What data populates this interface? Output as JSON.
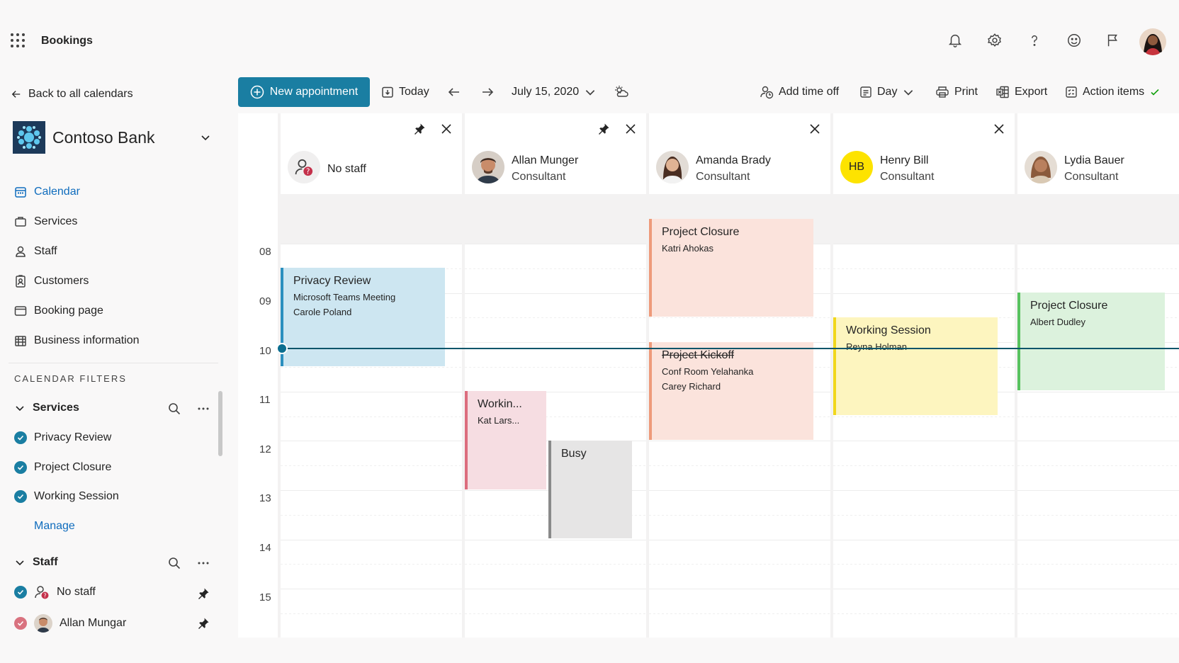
{
  "app": {
    "name": "Bookings"
  },
  "topbar": {
    "icons": [
      "bell-icon",
      "gear-icon",
      "help-icon",
      "smiley-icon",
      "flag-icon"
    ]
  },
  "sidebar": {
    "back_label": "Back to all calendars",
    "org_name": "Contoso Bank",
    "nav": [
      {
        "label": "Calendar",
        "icon": "calendar-icon",
        "active": true
      },
      {
        "label": "Services",
        "icon": "briefcase-icon"
      },
      {
        "label": "Staff",
        "icon": "person-icon"
      },
      {
        "label": "Customers",
        "icon": "contact-card-icon"
      },
      {
        "label": "Booking page",
        "icon": "web-page-icon"
      },
      {
        "label": "Business information",
        "icon": "building-icon"
      }
    ],
    "filters_heading": "CALENDAR FILTERS",
    "services_group": {
      "label": "Services",
      "items": [
        "Privacy Review",
        "Project Closure",
        "Working Session"
      ],
      "manage_label": "Manage"
    },
    "staff_group": {
      "label": "Staff",
      "items": [
        {
          "label": "No staff",
          "check_color": "#1a7ea2"
        },
        {
          "label": "Allan Mungar",
          "check_color": "#d9727f"
        }
      ]
    }
  },
  "toolbar": {
    "new_appointment": "New appointment",
    "today": "Today",
    "date": "July 15, 2020",
    "add_time_off": "Add time off",
    "view": "Day",
    "print": "Print",
    "export": "Export",
    "action_items": "Action items"
  },
  "calendar": {
    "hours": [
      "08",
      "09",
      "10",
      "11",
      "12",
      "13",
      "14",
      "15"
    ],
    "columns": [
      {
        "name": "No staff",
        "role": "",
        "initials": "",
        "pinned": true
      },
      {
        "name": "Allan Munger",
        "role": "Consultant",
        "initials": "",
        "pinned": true
      },
      {
        "name": "Amanda Brady",
        "role": "Consultant",
        "initials": "",
        "pinned": false
      },
      {
        "name": "Henry Bill",
        "role": "Consultant",
        "initials": "HB",
        "pinned": false
      },
      {
        "name": "Lydia Bauer",
        "role": "Consultant",
        "initials": "",
        "pinned": false
      }
    ],
    "appointments": [
      {
        "col": 0,
        "title": "Privacy Review",
        "lines": [
          "Microsoft Teams Meeting",
          "Carole Poland"
        ],
        "start": 8.5,
        "end": 10.5,
        "bg": "#cde6f1",
        "border": "#2a8fbf",
        "strike": false
      },
      {
        "col": 1,
        "title": "Workin...",
        "lines": [
          "Kat Lars..."
        ],
        "start": 11.0,
        "end": 13.0,
        "bg": "#f6dde2",
        "border": "#dc6d7e",
        "strike": false,
        "half": "left"
      },
      {
        "col": 1,
        "title": "Busy",
        "lines": [],
        "start": 12.0,
        "end": 14.0,
        "bg": "#e6e5e5",
        "border": "#8a8a8a",
        "strike": false,
        "half": "right"
      },
      {
        "col": 2,
        "title": "Project Closure",
        "lines": [
          "Katri Ahokas"
        ],
        "start": 7.5,
        "end": 9.5,
        "bg": "#fbe3dc",
        "border": "#ee9a7a",
        "strike": false
      },
      {
        "col": 2,
        "title": "Project Kickoff",
        "lines": [
          "Conf Room Yelahanka",
          "Carey Richard"
        ],
        "start": 10.0,
        "end": 12.0,
        "bg": "#fbe3dc",
        "border": "#ee9a7a",
        "strike": true
      },
      {
        "col": 3,
        "title": "Working Session",
        "lines": [
          "Reyna Holman"
        ],
        "start": 9.5,
        "end": 11.5,
        "bg": "#fdf5bf",
        "border": "#f1d71c",
        "strike": false
      },
      {
        "col": 4,
        "title": "Project Closure",
        "lines": [
          "Albert Dudley"
        ],
        "start": 9.0,
        "end": 11.0,
        "bg": "#dcf2dd",
        "border": "#58c25f",
        "strike": false
      }
    ],
    "now_hour": 10.12
  }
}
